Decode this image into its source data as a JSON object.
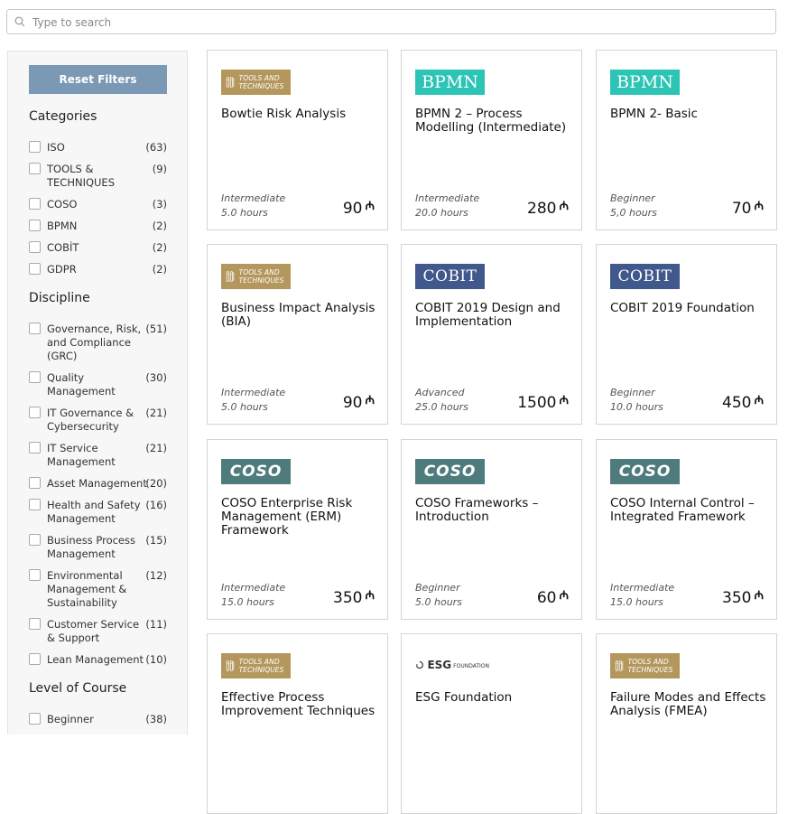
{
  "search": {
    "placeholder": "Type to search",
    "icon": "search-icon"
  },
  "sidebar": {
    "reset_label": "Reset Filters",
    "sections": [
      {
        "title": "Categories",
        "items": [
          {
            "label": "ISO",
            "count": "(63)"
          },
          {
            "label": "TOOLS & TECHNIQUES",
            "count": "(9)"
          },
          {
            "label": "COSO",
            "count": "(3)"
          },
          {
            "label": "BPMN",
            "count": "(2)"
          },
          {
            "label": "COBİT",
            "count": "(2)"
          },
          {
            "label": "GDPR",
            "count": "(2)"
          }
        ]
      },
      {
        "title": "Discipline",
        "items": [
          {
            "label": "Governance, Risk, and Compliance (GRC)",
            "count": "(51)"
          },
          {
            "label": "Quality Management",
            "count": "(30)"
          },
          {
            "label": "IT Governance & Cybersecurity",
            "count": "(21)"
          },
          {
            "label": "IT Service Management",
            "count": "(21)"
          },
          {
            "label": "Asset Management",
            "count": "(20)"
          },
          {
            "label": "Health and Safety Management",
            "count": "(16)"
          },
          {
            "label": "Business Process Management",
            "count": "(15)"
          },
          {
            "label": "Environmental Management & Sustainability",
            "count": "(12)"
          },
          {
            "label": "Customer Service & Support",
            "count": "(11)"
          },
          {
            "label": "Lean Management",
            "count": "(10)"
          }
        ]
      },
      {
        "title": "Level of Course",
        "items": [
          {
            "label": "Beginner",
            "count": "(38)"
          }
        ]
      }
    ]
  },
  "logos": {
    "tools": "TOOLS AND TECHNIQUES",
    "bpmn": "BPMN",
    "cobit": "COBIT",
    "coso": "COSO",
    "esg": "ESG",
    "esg_sub": "FOUNDATION"
  },
  "colors": {
    "tools": "#b4975d",
    "bpmn": "#2cc4b4",
    "cobit": "#41588c",
    "coso": "#4e7b7c",
    "reset": "#7b98b4"
  },
  "currency_symbol": "₼",
  "cards": [
    {
      "logo": "tools",
      "title": "Bowtie Risk Analysis",
      "level": "Intermediate",
      "hours": "5.0 hours",
      "price": "90"
    },
    {
      "logo": "bpmn",
      "title": "BPMN 2 – Process Modelling (Intermediate)",
      "level": "Intermediate",
      "hours": "20.0 hours",
      "price": "280"
    },
    {
      "logo": "bpmn",
      "title": "BPMN 2- Basic",
      "level": "Beginner",
      "hours": "5,0 hours",
      "price": "70"
    },
    {
      "logo": "tools",
      "title": "Business Impact Analysis (BIA)",
      "level": "Intermediate",
      "hours": "5.0 hours",
      "price": "90"
    },
    {
      "logo": "cobit",
      "title": "COBIT 2019 Design and Implementation",
      "level": "Advanced",
      "hours": "25.0 hours",
      "price": "1500"
    },
    {
      "logo": "cobit",
      "title": "COBIT 2019 Foundation",
      "level": "Beginner",
      "hours": "10.0 hours",
      "price": "450"
    },
    {
      "logo": "coso",
      "title": "COSO Enterprise Risk Management (ERM) Framework",
      "level": "Intermediate",
      "hours": "15.0 hours",
      "price": "350"
    },
    {
      "logo": "coso",
      "title": "COSO Frameworks – Introduction",
      "level": "Beginner",
      "hours": "5.0 hours",
      "price": "60"
    },
    {
      "logo": "coso",
      "title": "COSO Internal Control – Integrated Framework",
      "level": "Intermediate",
      "hours": "15.0 hours",
      "price": "350"
    },
    {
      "logo": "tools",
      "title": "Effective Process Improvement Techniques",
      "level": "",
      "hours": "",
      "price": ""
    },
    {
      "logo": "esg",
      "title": "ESG Foundation",
      "level": "",
      "hours": "",
      "price": ""
    },
    {
      "logo": "tools",
      "title": "Failure Modes and Effects Analysis (FMEA)",
      "level": "",
      "hours": "",
      "price": ""
    }
  ]
}
